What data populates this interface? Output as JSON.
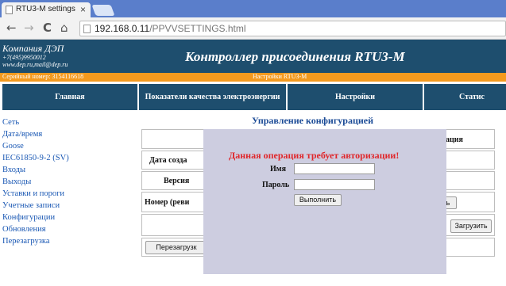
{
  "browser": {
    "tab_title": "RTU3-M settings",
    "tab_close": "×",
    "url_host": "192.168.0.11",
    "url_path": "/PPVVSETTINGS.html",
    "back": "←",
    "forward": "→",
    "reload": "C",
    "home": "⌂"
  },
  "header": {
    "company": "Компания ДЭП",
    "phone": "+7(495)9950012",
    "web": "www.dep.ru,mail@dep.ru",
    "title": "Контроллер присоединения RTU3-M"
  },
  "orange_bar": {
    "serial": "Серийный номер: 3154116618",
    "page": "Настройки RTU3-M"
  },
  "menu": [
    {
      "label": "Главная"
    },
    {
      "label": "Показатели качества электроэнергии"
    },
    {
      "label": "Настройки"
    },
    {
      "label": "Статис"
    }
  ],
  "sidebar": [
    {
      "label": "Сеть"
    },
    {
      "label": "Дата/время"
    },
    {
      "label": "Goose"
    },
    {
      "label": "IEC61850-9-2 (SV)"
    },
    {
      "label": "Входы"
    },
    {
      "label": "Выходы"
    },
    {
      "label": "Уставки и пороги"
    },
    {
      "label": "Учетные записи"
    },
    {
      "label": "Конфигурации"
    },
    {
      "label": "Обновления"
    },
    {
      "label": "Перезагрузка"
    }
  ],
  "main": {
    "section_title": "Управление конфигурацией",
    "row_header_right": "ация",
    "date_label": "Дата созда",
    "version_label": "Версия",
    "revision_label": "Номер (реви",
    "revision_btn_fragment": "ь",
    "load_button": "Загрузить",
    "reboot_button": "Перезагрузк"
  },
  "modal": {
    "message": "Данная операция требует авторизации!",
    "name_label": "Имя",
    "password_label": "Пароль",
    "submit": "Выполнить"
  }
}
